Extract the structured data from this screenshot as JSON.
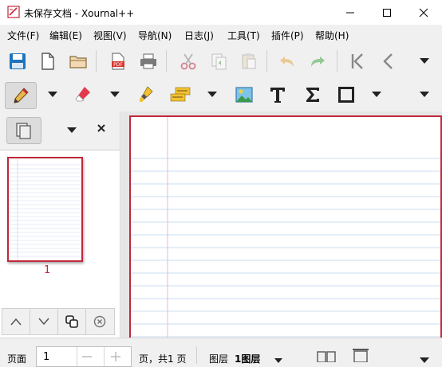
{
  "window": {
    "title": "未保存文档 - Xournal++"
  },
  "menu": [
    "文件(F)",
    "编辑(E)",
    "视图(V)",
    "导航(N)",
    "日志(J)",
    "工具(T)",
    "插件(P)",
    "帮助(H)"
  ],
  "sidebar": {
    "page_number": "1"
  },
  "statusbar": {
    "page_label": "页面",
    "page_value": "1",
    "total_label": "页，共1 页",
    "layer_label": "图层",
    "layer_value": "1图层"
  },
  "colors": {
    "accent": "#c0283a",
    "ruled_line": "#c9dcef",
    "margin_line": "#e8b5e0"
  }
}
